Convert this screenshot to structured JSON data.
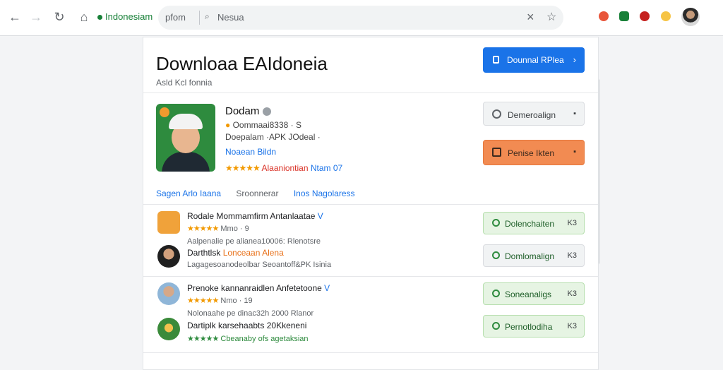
{
  "browser": {
    "site": "Indonesiam",
    "address_text": "pfom",
    "search_text": "Nesua",
    "icons": [
      "back-icon",
      "forward-icon",
      "reload-icon",
      "home-icon",
      "lock-icon",
      "close-icon",
      "star-icon"
    ]
  },
  "page": {
    "title": "Downloaa EAIdoneia",
    "subtitle": "Asld Kcl fonnia",
    "download_button": "Dounnal RPlea",
    "download_chevron": "›"
  },
  "app": {
    "name": "Dodam",
    "meta1": "Oommaai8338 · S",
    "meta2": "Doepalam ·APK JOdeal ·",
    "link": "Noaean Bildn",
    "stars": "★★★★★",
    "rating_red": "Alaaniontian",
    "rating_blue": "Ntam 07"
  },
  "actions": {
    "secondary_label": "Demeroalign",
    "primary_label": "Penise Ikten"
  },
  "sections": [
    "Sagen Arlo Iaana",
    "Sroonnerar",
    "Inos Nagolaress"
  ],
  "items": [
    {
      "title": "Rodale Mommamfirm Antanlaatae",
      "badge": "V",
      "stars": "★★★★★",
      "sub": "Mmo · 9",
      "detail": "Aalpenalie pe alianea10006: Rlenotsre",
      "btn": "Dolenchaiten",
      "tail": "K3",
      "style": "green"
    },
    {
      "title": "Darthtlsk",
      "highlight": "Lonceaan Alena",
      "stars": "",
      "sub": "",
      "detail": "Lagagesoanodeolbar Seoantoff&PK Isinia",
      "btn": "Domlomalign",
      "tail": "K3",
      "style": "gray"
    },
    {
      "title": "Prenoke kannanraidlen Anfetetoone",
      "badge": "V",
      "stars": "★★★★★",
      "sub": "Nmo · 19",
      "detail": "Nolonaahe pe dinac32h 2000 Rlanor",
      "btn": "Soneanaligs",
      "tail": "K3",
      "style": "green"
    },
    {
      "title": "Dartiplk karsehaabts 20Kkeneni",
      "highlight": "",
      "stars": "★★★★★",
      "sub": "Cbeanaby ofs agetaksian",
      "detail": "",
      "btn": "Pernotlodiha",
      "tail": "K3",
      "style": "green"
    }
  ],
  "colors": {
    "accent": "#1a73e8",
    "orange": "#f28b52",
    "green": "#2e8b3e",
    "star": "#f29900"
  }
}
